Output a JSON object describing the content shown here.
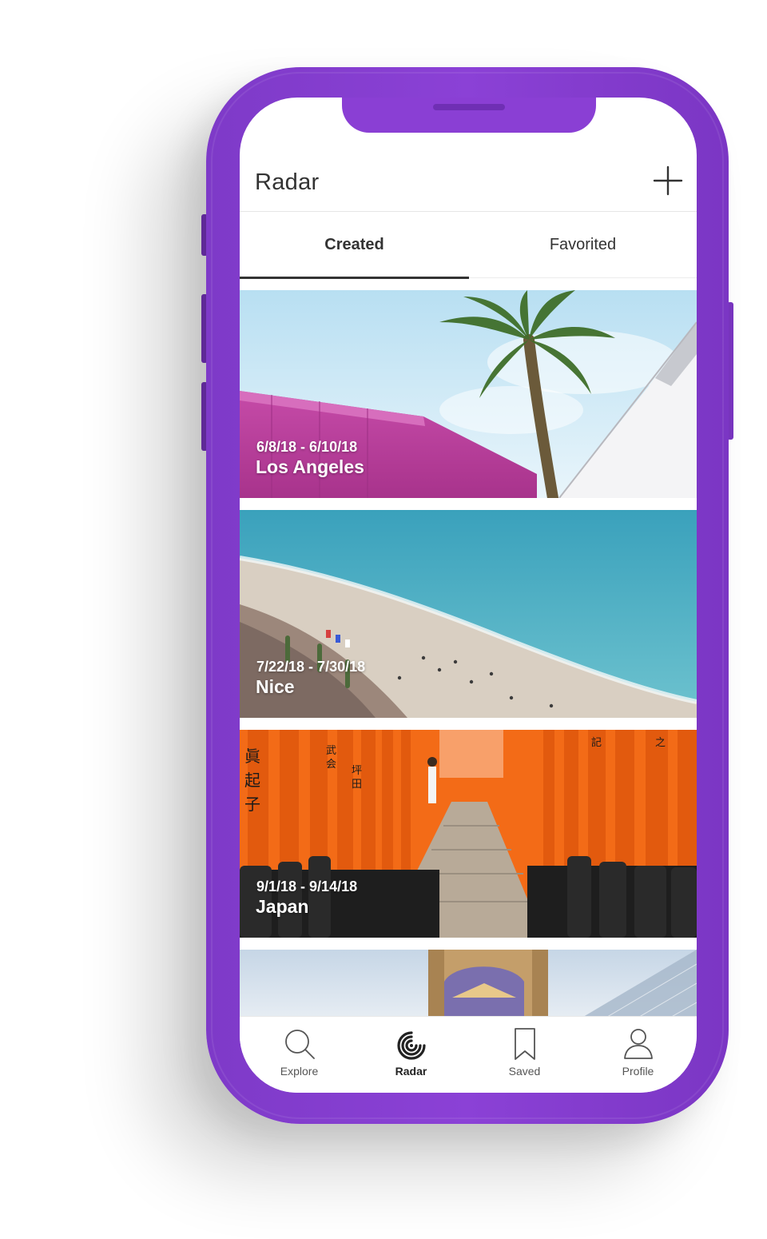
{
  "app": {
    "title": "Radar",
    "add_icon": "plus-icon",
    "brand_color": "#8a3fd4"
  },
  "tabs": [
    {
      "label": "Created",
      "active": true
    },
    {
      "label": "Favorited",
      "active": false
    }
  ],
  "trips": [
    {
      "dates": "6/8/18 - 6/10/18",
      "place": "Los Angeles"
    },
    {
      "dates": "7/22/18 - 7/30/18",
      "place": "Nice"
    },
    {
      "dates": "9/1/18 - 9/14/18",
      "place": "Japan"
    }
  ],
  "nav": [
    {
      "label": "Explore",
      "icon": "search-icon",
      "active": false
    },
    {
      "label": "Radar",
      "icon": "radar-icon",
      "active": true
    },
    {
      "label": "Saved",
      "icon": "bookmark-icon",
      "active": false
    },
    {
      "label": "Profile",
      "icon": "user-icon",
      "active": false
    }
  ]
}
